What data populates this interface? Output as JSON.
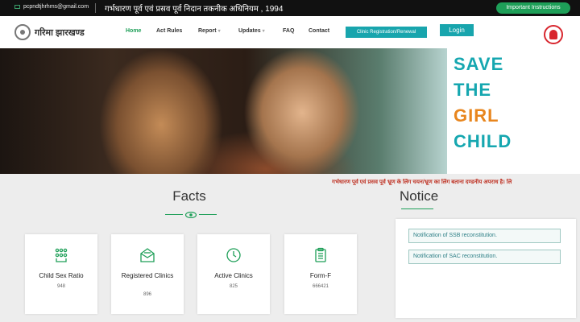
{
  "topbar": {
    "email": "pcpndtjhrhms@gmail.com",
    "act_title": "गर्भधारण पूर्व एवं प्रसव पूर्व निदान तकनीक अधिनियम , 1994",
    "important_btn": "Important Instructions"
  },
  "header": {
    "logo_text": "गरिमा झारखण्ड",
    "nav": [
      "Home",
      "Act Rules",
      "Report",
      "Updates",
      "FAQ",
      "Contact"
    ],
    "active_nav": "Home",
    "clinic_btn": "Clinic Registration/Renewal",
    "login_btn": "Login"
  },
  "hero": {
    "slogan_lines": [
      "SAVE",
      "THE",
      "GIRL",
      "CHILD"
    ],
    "slogan_colors": [
      "#16a7b0",
      "#16a7b0",
      "#e8861e",
      "#16a7b0"
    ]
  },
  "ticker": {
    "text": "गर्भधारण पूर्व एवं प्रसव पूर्व भ्रूण के लिंग चयन/भ्रूण का लिंग बताना दण्डनीय अपराध है। लि"
  },
  "facts": {
    "heading": "Facts",
    "cards": [
      {
        "label": "Child Sex Ratio",
        "value": "948",
        "icon": "child-sex-ratio-icon"
      },
      {
        "label": "Registered Clinics",
        "value": "896",
        "icon": "mail-open-icon"
      },
      {
        "label": "Active Clinics",
        "value": "825",
        "icon": "clock-icon"
      },
      {
        "label": "Form-F",
        "value": "666421",
        "icon": "clipboard-icon"
      }
    ]
  },
  "notice": {
    "heading": "Notice",
    "items": [
      "Notification of SSB reconstitution.",
      "Notification of SAC reconstitution."
    ]
  },
  "colors": {
    "accent": "#1e9f58",
    "teal": "#18a5ad",
    "ticker": "#c0392b"
  }
}
